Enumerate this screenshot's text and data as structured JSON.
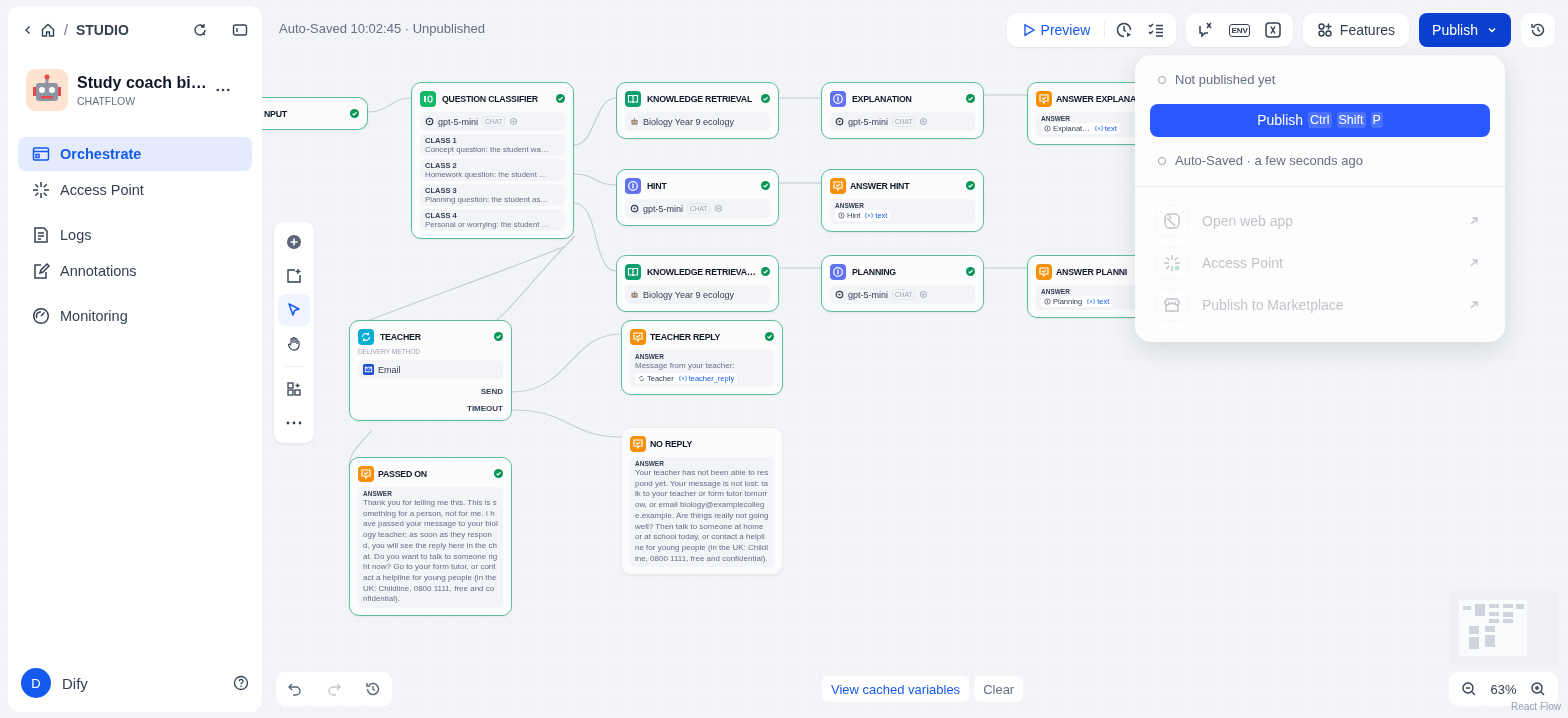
{
  "sidebar": {
    "separator": "/",
    "breadcrumb": "STUDIO",
    "app": {
      "name": "Study coach bi…",
      "type": "CHATFLOW"
    },
    "nav": [
      {
        "label": "Orchestrate",
        "selected": true
      },
      {
        "label": "Access Point",
        "selected": false
      },
      {
        "label": "Logs",
        "selected": false
      },
      {
        "label": "Annotations",
        "selected": false
      },
      {
        "label": "Monitoring",
        "selected": false
      }
    ],
    "user": {
      "initial": "D",
      "name": "Dify"
    }
  },
  "header": {
    "status": "Auto-Saved 10:02:45 · Unpublished",
    "preview": "Preview",
    "env": "ENV",
    "features": "Features",
    "publish": "Publish"
  },
  "publish_menu": {
    "status": "Not published yet",
    "button": "Publish",
    "keys": [
      "Ctrl",
      "Shift",
      "P"
    ],
    "autosave": "Auto-Saved · a few seconds ago",
    "items": [
      {
        "label": "Open web app",
        "disabled": true
      },
      {
        "label": "Access Point",
        "disabled": true
      },
      {
        "label": "Publish to Marketplace",
        "disabled": true
      }
    ]
  },
  "nodes": [
    {
      "kind": "input",
      "title": "NPUT",
      "passed": true
    },
    {
      "kind": "classifier",
      "title": "QUESTION CLASSIFIER",
      "passed": true,
      "model": {
        "name": "gpt-5-mini",
        "mode": "CHAT"
      },
      "classes": [
        {
          "label": "CLASS 1",
          "text": "Concept question: the student wa…"
        },
        {
          "label": "CLASS 2",
          "text": "Homework question: the student …"
        },
        {
          "label": "CLASS 3",
          "text": "Planning question: the student as…"
        },
        {
          "label": "CLASS 4",
          "text": "Personal or worrying: the student …"
        }
      ]
    },
    {
      "kind": "knowledge",
      "title": "KNOWLEDGE RETRIEVAL",
      "passed": true,
      "dataset": "Biology Year 9 ecology"
    },
    {
      "kind": "llm",
      "title": "EXPLANATION",
      "passed": true,
      "model": {
        "name": "gpt-5-mini",
        "mode": "CHAT"
      }
    },
    {
      "kind": "answer",
      "title": "ANSWER EXPLANA",
      "passed": true,
      "label": "ANSWER",
      "vars": [
        {
          "kind": "llm",
          "source": "Explanat…",
          "name": "text"
        }
      ]
    },
    {
      "kind": "llm",
      "title": "HINT",
      "passed": true,
      "model": {
        "name": "gpt-5-mini",
        "mode": "CHAT"
      }
    },
    {
      "kind": "answer",
      "title": "ANSWER HINT",
      "passed": true,
      "label": "ANSWER",
      "vars": [
        {
          "kind": "llm",
          "source": "Hint",
          "name": "text"
        }
      ]
    },
    {
      "kind": "knowledge",
      "title": "KNOWLEDGE RETRIEVA…",
      "passed": true,
      "dataset": "Biology Year 9 ecology"
    },
    {
      "kind": "llm",
      "title": "PLANNING",
      "passed": true,
      "model": {
        "name": "gpt-5-mini",
        "mode": "CHAT"
      }
    },
    {
      "kind": "answer",
      "title": "ANSWER PLANNI",
      "passed": true,
      "label": "ANSWER",
      "vars": [
        {
          "kind": "llm",
          "source": "Planning",
          "name": "text"
        }
      ]
    },
    {
      "kind": "human",
      "title": "TEACHER",
      "passed": true,
      "delivery_label": "DELIVERY METHOD",
      "method": "Email",
      "outputs": [
        "SEND",
        "TIMEOUT"
      ]
    },
    {
      "kind": "answer",
      "title": "TEACHER REPLY",
      "passed": true,
      "label": "ANSWER",
      "text": "Message from your teacher:",
      "vars": [
        {
          "kind": "human",
          "source": "Teacher",
          "name": "teacher_reply"
        }
      ]
    },
    {
      "kind": "answer",
      "title": "NO REPLY",
      "passed": false,
      "label": "ANSWER",
      "text": "Your teacher has not been able to respond yet. Your message is not lost: talk to your teacher or form tutor tomorrow, or email biology@examplecollege.example. Are things really not going well? Then talk to someone at home or at school today, or contact a helpline for young people (in the UK: Childline, 0800 1111, free and confidential)."
    },
    {
      "kind": "answer",
      "title": "PASSED ON",
      "passed": true,
      "label": "ANSWER",
      "text": "Thank you for telling me this. This is something for a person, not for me. I have passed your message to your biology teacher; as soon as they respond, you will see the reply here in the chat. Do you want to talk to someone right now? Go to your form tutor, or contact a helpline for young people (in the UK: Childline, 0800 1111, free and confidential)."
    }
  ],
  "tools": [
    {
      "kind": "add",
      "selected": false
    },
    {
      "kind": "note",
      "selected": false
    },
    {
      "kind": "pointer",
      "selected": true
    },
    {
      "kind": "hand",
      "selected": false
    },
    {
      "kind": "layout",
      "selected": false
    },
    {
      "kind": "more",
      "selected": false
    }
  ],
  "footer": {
    "redo_disabled": true,
    "cached": "View cached variables",
    "clear": "Clear",
    "zoom": "63%",
    "attribution": "React Flow"
  }
}
